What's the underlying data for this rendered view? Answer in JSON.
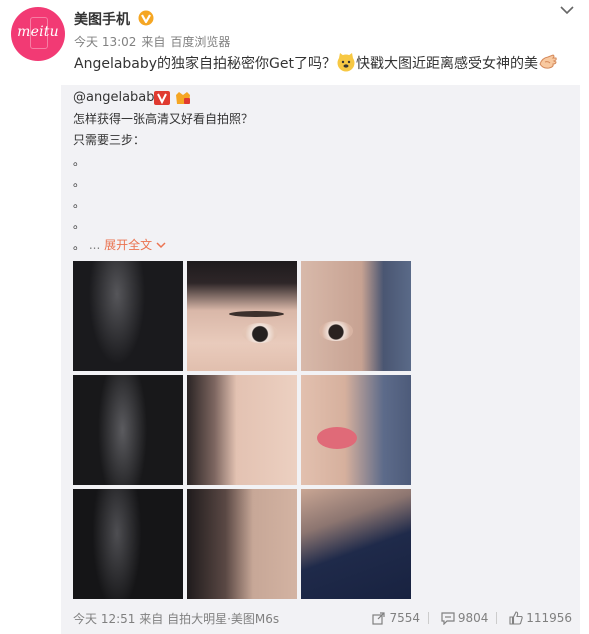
{
  "post": {
    "author": "美图手机",
    "meta": {
      "time": "今天 13:02",
      "source_prefix": "来自",
      "source": "百度浏览器"
    },
    "text_a": "Angelababy的独家自拍秘密你Get了吗？",
    "text_b": "快戳大图近距离感受女神的美",
    "avatar_text": "meitu",
    "colors": {
      "brand": "#f23a74",
      "link": "#eb7350",
      "verified": "#f5a623"
    }
  },
  "repost": {
    "author": "@angelababy",
    "line1": "怎样获得一张高清又好看自拍照？",
    "line2": "只需要三步：",
    "bullets": [
      "。",
      "。",
      "。",
      "。",
      "。"
    ],
    "ellipsis": "...",
    "expand": "展开全文",
    "footer": {
      "time": "今天 12:51",
      "source_prefix": "来自",
      "source": "自拍大明星·美图M6s",
      "repost_count": "7554",
      "comment_count": "9804",
      "like_count": "111956"
    }
  }
}
